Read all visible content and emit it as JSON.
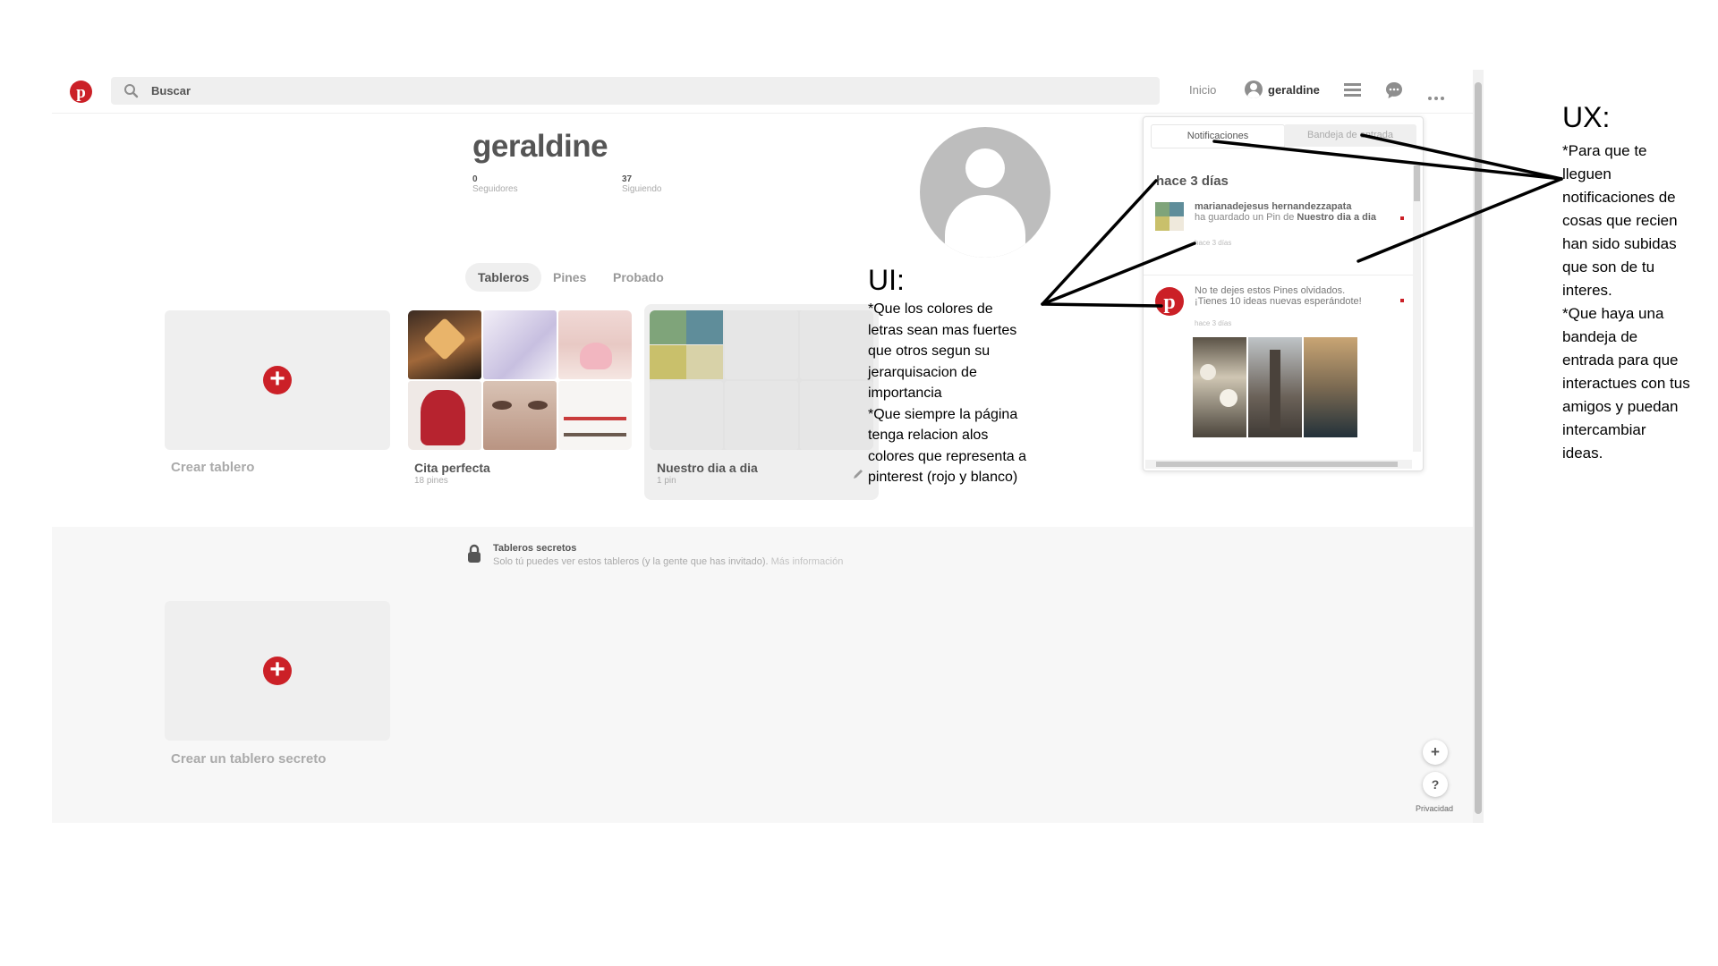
{
  "header": {
    "search_placeholder": "Buscar",
    "home_label": "Inicio",
    "username": "geraldine"
  },
  "profile": {
    "name": "geraldine",
    "followers_count": "0",
    "followers_label": "Seguidores",
    "following_count": "37",
    "following_label": "Siguiendo"
  },
  "tabs": [
    "Tableros",
    "Pines",
    "Probado"
  ],
  "boards": [
    {
      "title": "Crear tablero"
    },
    {
      "title": "Cita perfecta",
      "count": "18 pines"
    },
    {
      "title": "Nuestro dia a dia",
      "count": "1 pin"
    }
  ],
  "secret": {
    "title": "Tableros secretos",
    "description": "Solo tú puedes ver estos tableros (y la gente que has invitado).",
    "more_link": "Más información",
    "create_label": "Crear un tablero secreto"
  },
  "notifications": {
    "tab_notifications": "Notificaciones",
    "tab_inbox": "Bandeja de entrada",
    "section_header": "hace 3 días",
    "items": [
      {
        "user": "marianadejesus hernandezzapata",
        "text_prefix": "ha guardado un Pin de ",
        "board": "Nuestro dia a dia",
        "time": "hace 3 días"
      },
      {
        "text": "No te dejes estos Pines olvidados. ¡Tienes 10 ideas nuevas esperándote!",
        "time": "hace 3 días"
      }
    ]
  },
  "fab": {
    "plus": "+",
    "help": "?",
    "privacy_label": "Privacidad"
  },
  "annotations": {
    "ui_title": "UI:",
    "ui_body": "*Que los colores de\nletras sean mas fuertes\nque otros segun su\njerarquisacion de\nimportancia\n*Que siempre la página\ntenga relacion alos\ncolores que representa a\npinterest (rojo y blanco)",
    "ux_title": "UX:",
    "ux_body": "*Para que te\nlleguen\nnotificaciones de\ncosas que recien\nhan sido subidas\nque son de tu\ninteres.\n*Que haya una\nbandeja de\nentrada para que\ninteractues con tus\namigos y puedan\nintercambiar\nideas."
  },
  "colors": {
    "brand_red": "#cb2027",
    "background_grey": "#efefef"
  }
}
